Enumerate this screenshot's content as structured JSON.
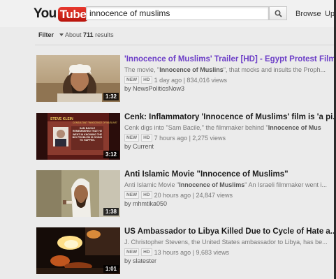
{
  "header": {
    "logo_you": "You",
    "logo_tube": "Tube",
    "search_value": "innocence of muslims",
    "browse_label": "Browse",
    "upload_label": "Upl"
  },
  "filterbar": {
    "filter_label": "Filter",
    "about_prefix": "About",
    "result_count": "711",
    "about_suffix": "results"
  },
  "results": [
    {
      "title": "'Innocence of Muslims' Trailer [HD] - Egypt Protest Film",
      "desc_pre": "The movie, \"",
      "desc_bold": "Innocence of Muslins",
      "desc_post": "\", that mocks and insults the Proph...",
      "badges": [
        "NEW",
        "HD"
      ],
      "meta": "1 day ago | 834,016 views",
      "by": "by NewsPoliticsNow3",
      "duration": "1:32"
    },
    {
      "title": "Cenk: Inflammatory 'Innocence of Muslims' film is 'a pi...",
      "desc_pre": "Cenk digs into \"Sam Bacile,\" the filmmaker behind \"",
      "desc_bold": "Innocence of Mus",
      "desc_post": "",
      "badges": [
        "NEW",
        "HD"
      ],
      "meta": "7 hours ago | 2,275 views",
      "by": "by Current",
      "duration": "3:12",
      "thumb_caption_1": "STEVE KLEIN",
      "thumb_caption_2": "CONSULTANT \"INNOCENCE OF MUSLIMS\"",
      "thumb_quote": "SAM BACILE REMEMBERED THAT HE WENT IN KNOWING THE BIG PROBLEM IS GOING TO HAPPEN."
    },
    {
      "title": "Anti Islamic Movie \"Innocence of Muslims\"",
      "desc_pre": "Anti Islamic Movie \"",
      "desc_bold": "Innocence of Muslims",
      "desc_post": "\" An Israeli filmmaker went i...",
      "badges": [
        "NEW",
        "HD"
      ],
      "meta": "20 hours ago | 24,847 views",
      "by": "by mhmtika050",
      "duration": "1:38"
    },
    {
      "title": "US Ambassador to Libya Killed Due to Cycle of Hate a...",
      "desc_pre": "J. Christopher Stevens, the United States ambassador to Libya, has be...",
      "desc_bold": "",
      "desc_post": "",
      "badges": [
        "NEW",
        "HD"
      ],
      "meta": "13 hours ago | 9,683 views",
      "by": "by slatester",
      "duration": "1:01"
    }
  ]
}
